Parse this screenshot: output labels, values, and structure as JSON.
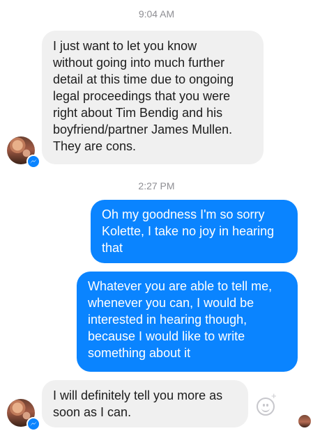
{
  "thread": {
    "timestamp_1": "9:04 AM",
    "timestamp_2": "2:27 PM",
    "messages": [
      {
        "direction": "incoming",
        "text": "I just want to let you know\nwithout going into much further\ndetail at this time due to ongoing\nlegal proceedings that you were\nright about Tim Bendig and his\nboyfriend/partner James Mullen.\nThey are cons."
      },
      {
        "direction": "outgoing",
        "text": "Oh my goodness I'm so sorry\nKolette, I take no joy in hearing\nthat"
      },
      {
        "direction": "outgoing",
        "text": "Whatever you are able to tell me,\nwhenever you can, I would be\ninterested in hearing though,\nbecause I would like to write\nsomething about it"
      },
      {
        "direction": "incoming",
        "text": "I will definitely tell you more as\nsoon as I can."
      }
    ]
  },
  "icons": {
    "avatar": "contact-avatar",
    "badge": "messenger-badge-icon",
    "reaction": "add-reaction-icon",
    "read_receipt": "read-receipt-avatar"
  },
  "colors": {
    "outgoing_bubble": "#0a84ff",
    "incoming_bubble": "#f0f0f0",
    "timestamp": "#8e8e93"
  },
  "reaction_plus": "+"
}
